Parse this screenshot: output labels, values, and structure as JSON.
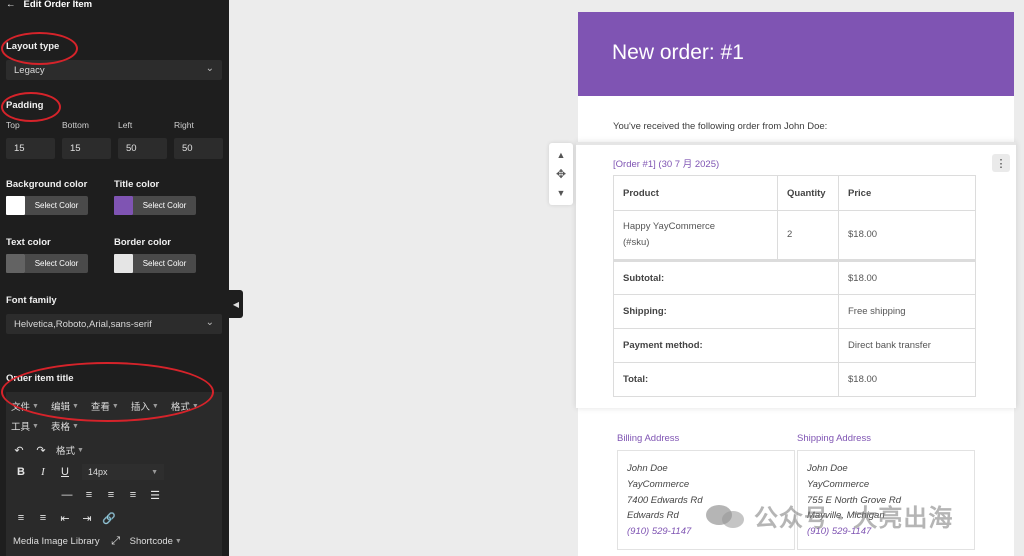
{
  "sidebar": {
    "header_title": "Edit Order Item",
    "layout_type": {
      "label": "Layout type",
      "value": "Legacy"
    },
    "padding": {
      "label": "Padding",
      "sides": [
        {
          "label": "Top",
          "value": "15"
        },
        {
          "label": "Bottom",
          "value": "15"
        },
        {
          "label": "Left",
          "value": "50"
        },
        {
          "label": "Right",
          "value": "50"
        }
      ]
    },
    "colors": {
      "select_label": "Select Color",
      "background": {
        "label": "Background color",
        "swatch": "#ffffff"
      },
      "title": {
        "label": "Title color",
        "swatch": "#7f54b3"
      },
      "text": {
        "label": "Text color",
        "swatch": "#636363"
      },
      "border": {
        "label": "Border color",
        "swatch": "#e5e5e5"
      }
    },
    "font_family": {
      "label": "Font family",
      "value": "Helvetica,Roboto,Arial,sans-serif"
    },
    "order_item_title": {
      "label": "Order item title",
      "menu": [
        "文件",
        "编辑",
        "查看",
        "插入",
        "格式",
        "工具",
        "表格"
      ],
      "format_label": "格式",
      "font_size": "14px",
      "media_label": "Media Image Library",
      "shortcode_label": "Shortcode"
    }
  },
  "email": {
    "header_title": "New order: #1",
    "header_color": "#7f54b3",
    "intro": "You've received the following order from John Doe:",
    "order_link": "[Order #1] (30 7 月 2025)",
    "table": {
      "headers": [
        "Product",
        "Quantity",
        "Price"
      ],
      "product": {
        "name": "Happy YayCommerce",
        "sku": "(#sku)",
        "quantity": "2",
        "price": "$18.00"
      },
      "summary": [
        {
          "label": "Subtotal:",
          "value": "$18.00"
        },
        {
          "label": "Shipping:",
          "value": "Free shipping"
        },
        {
          "label": "Payment method:",
          "value": "Direct bank transfer"
        },
        {
          "label": "Total:",
          "value": "$18.00"
        }
      ]
    },
    "billing": {
      "title": "Billing Address",
      "lines": [
        "John Doe",
        "YayCommerce",
        "7400 Edwards Rd",
        "Edwards Rd"
      ],
      "phone": "(910) 529-1147"
    },
    "shipping": {
      "title": "Shipping Address",
      "lines": [
        "John Doe",
        "YayCommerce",
        "755 E North Grove Rd",
        "Mayville, Michigan"
      ],
      "phone": "(910) 529-1147"
    }
  },
  "watermark": {
    "text": "公众号 · 大亮出海"
  }
}
